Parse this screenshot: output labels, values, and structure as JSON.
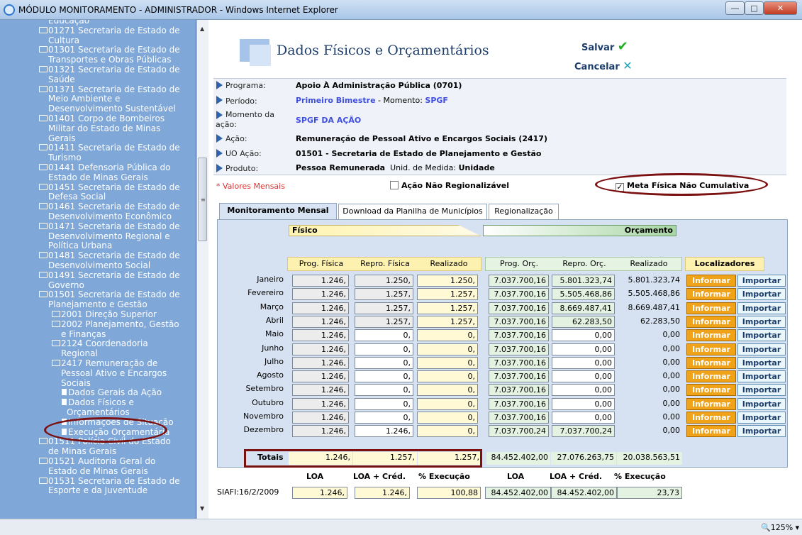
{
  "window": {
    "title": "MÓDULO MONITORAMENTO - ADMINISTRADOR - Windows Internet Explorer",
    "zoom": "125%"
  },
  "sidebar": {
    "items": [
      {
        "text": "Educação",
        "icon": "none"
      },
      {
        "text": "01271 Secretaria de Estado de",
        "icon": "folder"
      },
      {
        "text": "Cultura",
        "icon": "none"
      },
      {
        "text": "01301 Secretaria de Estado de",
        "icon": "folder"
      },
      {
        "text": "Transportes e Obras Públicas",
        "icon": "none"
      },
      {
        "text": "01321 Secretaria de Estado de",
        "icon": "folder"
      },
      {
        "text": "Saúde",
        "icon": "none"
      },
      {
        "text": "01371 Secretaria de Estado de",
        "icon": "folder"
      },
      {
        "text": "Meio Ambiente e",
        "icon": "none"
      },
      {
        "text": "Desenvolvimento Sustentável",
        "icon": "none"
      },
      {
        "text": "01401 Corpo de Bombeiros",
        "icon": "folder"
      },
      {
        "text": "Militar do Estado de Minas",
        "icon": "none"
      },
      {
        "text": "Gerais",
        "icon": "none"
      },
      {
        "text": "01411 Secretaria de Estado de",
        "icon": "folder"
      },
      {
        "text": "Turismo",
        "icon": "none"
      },
      {
        "text": "01441 Defensoria Pública do",
        "icon": "folder"
      },
      {
        "text": "Estado de Minas Gerais",
        "icon": "none"
      },
      {
        "text": "01451 Secretaria de Estado de",
        "icon": "folder"
      },
      {
        "text": "Defesa Social",
        "icon": "none"
      },
      {
        "text": "01461 Secretaria de Estado de",
        "icon": "folder"
      },
      {
        "text": "Desenvolvimento Econômico",
        "icon": "none"
      },
      {
        "text": "01471 Secretaria de Estado de",
        "icon": "folder"
      },
      {
        "text": "Desenvolvimento Regional e",
        "icon": "none"
      },
      {
        "text": "Política Urbana",
        "icon": "none"
      },
      {
        "text": "01481 Secretaria de Estado de",
        "icon": "folder"
      },
      {
        "text": "Desenvolvimento Social",
        "icon": "none"
      },
      {
        "text": "01491 Secretaria de Estado de",
        "icon": "folder"
      },
      {
        "text": "Governo",
        "icon": "none"
      },
      {
        "text": "01501 Secretaria de Estado de",
        "icon": "folder-open"
      },
      {
        "text": "Planejamento e Gestão",
        "icon": "none"
      },
      {
        "text": "2001 Direção Superior",
        "icon": "folder"
      },
      {
        "text": "2002 Planejamento, Gestão",
        "icon": "folder"
      },
      {
        "text": "e Finanças",
        "icon": "none"
      },
      {
        "text": "2124 Coordenadoria",
        "icon": "folder"
      },
      {
        "text": "Regional",
        "icon": "none"
      },
      {
        "text": "2417 Remuneração de",
        "icon": "folder-open"
      },
      {
        "text": "Pessoal Ativo e Encargos",
        "icon": "none"
      },
      {
        "text": "Sociais",
        "icon": "none"
      },
      {
        "text": "Dados Gerais da Ação",
        "icon": "page"
      },
      {
        "text": "Dados Físicos e",
        "icon": "page"
      },
      {
        "text": "Orçamentários",
        "icon": "none"
      },
      {
        "text": "Informações de Situação",
        "icon": "page"
      },
      {
        "text": "Execução Orçamentária",
        "icon": "page"
      },
      {
        "text": "01511 Polícia Civil do Estado",
        "icon": "folder"
      },
      {
        "text": "de Minas Gerais",
        "icon": "none"
      },
      {
        "text": "01521 Auditoria Geral do",
        "icon": "folder"
      },
      {
        "text": "Estado de Minas Gerais",
        "icon": "none"
      },
      {
        "text": "01531 Secretaria de Estado de",
        "icon": "folder"
      },
      {
        "text": "Esporte e da Juventude",
        "icon": "none"
      }
    ]
  },
  "header": {
    "title": "Dados Físicos e Orçamentários",
    "save": "Salvar",
    "cancel": "Cancelar"
  },
  "info": {
    "programa_label": "Programa:",
    "programa": "Apoio À Administração Pública (0701)",
    "periodo_label": "Período:",
    "periodo": "Primeiro Bimestre",
    "momento_sep": " - Momento: ",
    "momento": "SPGF",
    "momento_acao_label_1": "Momento da",
    "momento_acao_label_2": "ação:",
    "momento_acao": "SPGF DA AÇÃO",
    "acao_label": "Ação:",
    "acao": "Remuneração de Pessoal Ativo e Encargos Sociais (2417)",
    "uo_label": "UO Ação:",
    "uo": "01501 - Secretaria de Estado de Planejamento e Gestão",
    "produto_label": "Produto:",
    "produto": "Pessoa Remunerada",
    "unid_label": "  Unid. de Medida: ",
    "unid": "Unidade"
  },
  "options": {
    "valores": "* Valores Mensais",
    "acao_nao_regionalizavel": "Ação Não Regionalizável",
    "meta_fisica": "Meta Física Não Cumulativa",
    "meta_checked": "✓"
  },
  "tabs": [
    "Monitoramento Mensal",
    "Download da Planilha de Municípios",
    "Regionalização"
  ],
  "sections": {
    "fisico": "Físico",
    "orcamento": "Orçamento"
  },
  "columns": {
    "prog_fisica": "Prog. Física",
    "repro_fisica": "Repro. Física",
    "realizado_f": "Realizado",
    "prog_orc": "Prog. Orç.",
    "repro_orc": "Repro. Orç.",
    "realizado_o": "Realizado",
    "localizadores": "Localizadores"
  },
  "buttons": {
    "informar": "Informar",
    "importar": "Importar"
  },
  "rows": [
    {
      "month": "Janeiro",
      "pf": "1.246,",
      "rf": "1.250,",
      "rz": "1.250,",
      "po": "7.037.700,16",
      "ro": "5.801.323,74",
      "ro2": "5.801.323,74"
    },
    {
      "month": "Fevereiro",
      "pf": "1.246,",
      "rf": "1.257,",
      "rz": "1.257,",
      "po": "7.037.700,16",
      "ro": "5.505.468,86",
      "ro2": "5.505.468,86"
    },
    {
      "month": "Março",
      "pf": "1.246,",
      "rf": "1.257,",
      "rz": "1.257,",
      "po": "7.037.700,16",
      "ro": "8.669.487,41",
      "ro2": "8.669.487,41"
    },
    {
      "month": "Abril",
      "pf": "1.246,",
      "rf": "1.257,",
      "rz": "1.257,",
      "po": "7.037.700,16",
      "ro": "62.283,50",
      "ro2": "62.283,50"
    },
    {
      "month": "Maio",
      "pf": "1.246,",
      "rf": "0,",
      "rz": "0,",
      "po": "7.037.700,16",
      "ro": "0,00",
      "ro2": "0,00"
    },
    {
      "month": "Junho",
      "pf": "1.246,",
      "rf": "0,",
      "rz": "0,",
      "po": "7.037.700,16",
      "ro": "0,00",
      "ro2": "0,00"
    },
    {
      "month": "Julho",
      "pf": "1.246,",
      "rf": "0,",
      "rz": "0,",
      "po": "7.037.700,16",
      "ro": "0,00",
      "ro2": "0,00"
    },
    {
      "month": "Agosto",
      "pf": "1.246,",
      "rf": "0,",
      "rz": "0,",
      "po": "7.037.700,16",
      "ro": "0,00",
      "ro2": "0,00"
    },
    {
      "month": "Setembro",
      "pf": "1.246,",
      "rf": "0,",
      "rz": "0,",
      "po": "7.037.700,16",
      "ro": "0,00",
      "ro2": "0,00"
    },
    {
      "month": "Outubro",
      "pf": "1.246,",
      "rf": "0,",
      "rz": "0,",
      "po": "7.037.700,16",
      "ro": "0,00",
      "ro2": "0,00"
    },
    {
      "month": "Novembro",
      "pf": "1.246,",
      "rf": "0,",
      "rz": "0,",
      "po": "7.037.700,16",
      "ro": "0,00",
      "ro2": "0,00"
    },
    {
      "month": "Dezembro",
      "pf": "1.246,",
      "rf": "1.246,",
      "rz": "0,",
      "po": "7.037.700,24",
      "ro": "7.037.700,24",
      "ro2": "0,00"
    }
  ],
  "totais": {
    "label": "Totais",
    "pf": "1.246,",
    "rf": "1.257,",
    "rz": "1.257,",
    "po": "84.452.402,00",
    "ro": "27.076.263,75",
    "ro2": "20.038.563,51"
  },
  "loa": {
    "h1": "LOA",
    "h2": "LOA + Créd.",
    "h3": "% Execução",
    "h4": "LOA",
    "h5": "LOA + Créd.",
    "h6": "% Execução",
    "siafi": "SIAFI:16/2/2009",
    "v1": "1.246,",
    "v2": "1.246,",
    "v3": "100,88",
    "v4": "84.452.402,00",
    "v5": "84.452.402,00",
    "v6": "23,73"
  }
}
